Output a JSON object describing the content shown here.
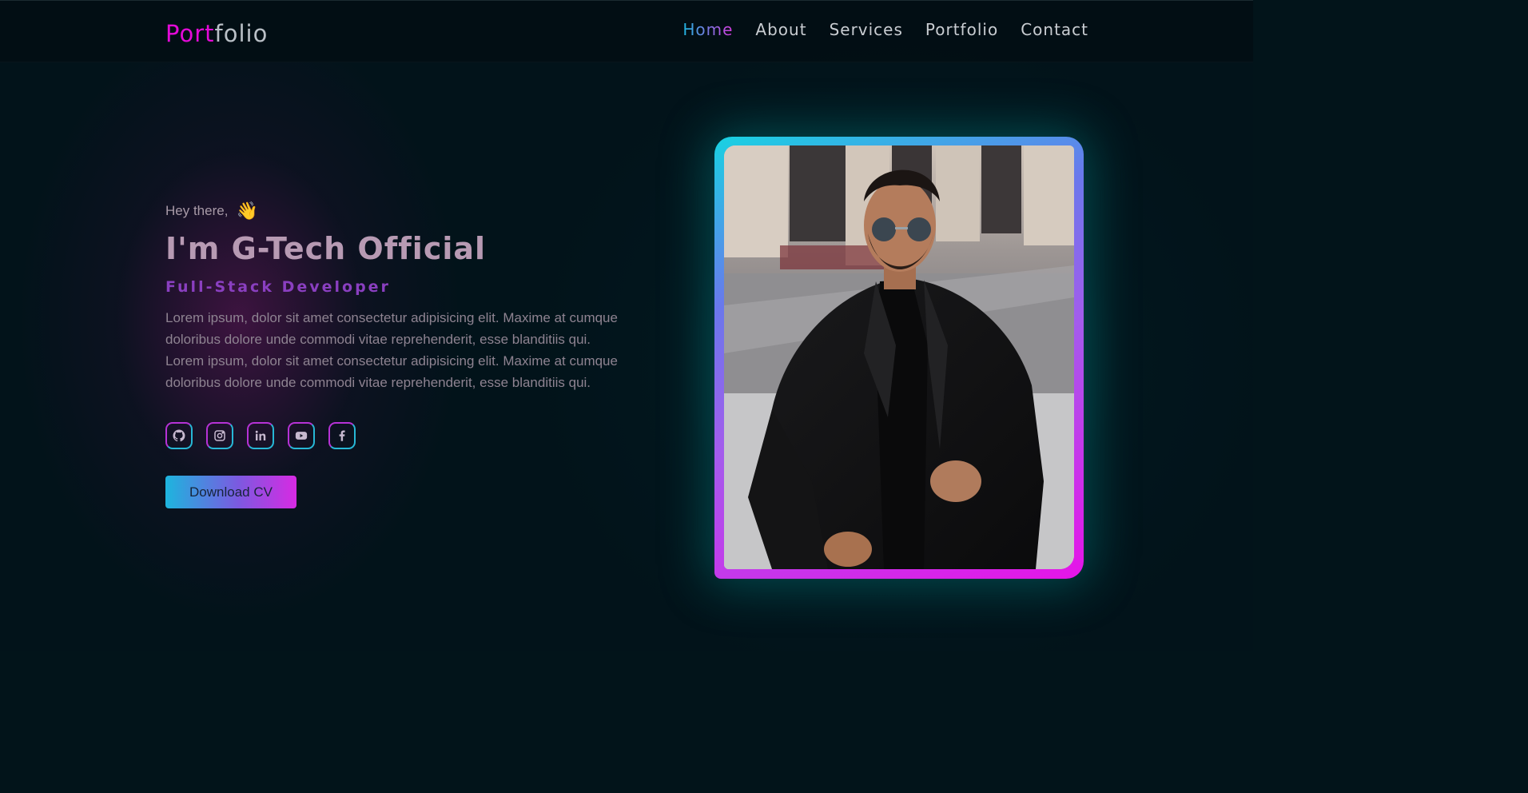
{
  "logo": {
    "part1": "Port",
    "part2": "folio"
  },
  "nav": {
    "items": [
      {
        "label": "Home",
        "active": true
      },
      {
        "label": "About",
        "active": false
      },
      {
        "label": "Services",
        "active": false
      },
      {
        "label": "Portfolio",
        "active": false
      },
      {
        "label": "Contact",
        "active": false
      }
    ]
  },
  "hero": {
    "greeting": "Hey there,",
    "wave_emoji": "👋",
    "name": "I'm G-Tech Official",
    "role": "Full-Stack Developer",
    "description": [
      "Lorem ipsum, dolor sit amet consectetur adipisicing elit. Maxime at cumque",
      "doloribus dolore unde commodi vitae reprehenderit, esse blanditiis qui.",
      "Lorem ipsum, dolor sit amet consectetur adipisicing elit. Maxime at cumque",
      "doloribus dolore unde commodi vitae reprehenderit, esse blanditiis qui."
    ],
    "socials": [
      {
        "icon": "github-icon"
      },
      {
        "icon": "instagram-icon"
      },
      {
        "icon": "linkedin-icon"
      },
      {
        "icon": "youtube-icon"
      },
      {
        "icon": "facebook-icon"
      }
    ],
    "cv_button": "Download CV"
  },
  "colors": {
    "accent_pink": "#e40ad8",
    "accent_cyan": "#1bb7e0",
    "background": "#02131a"
  }
}
